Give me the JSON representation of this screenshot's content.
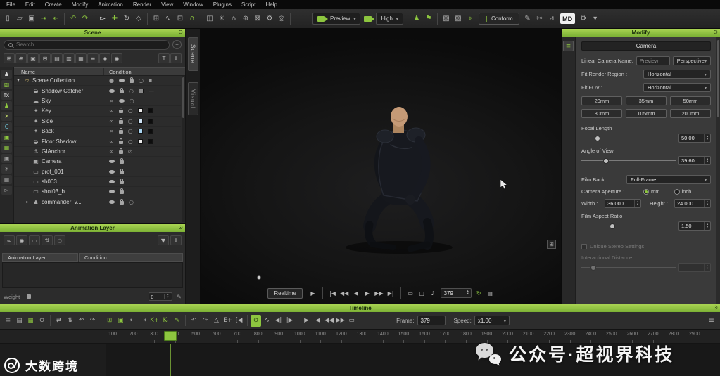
{
  "accent": "#8dc63f",
  "menubar": {
    "items": [
      "File",
      "Edit",
      "Create",
      "Modify",
      "Animation",
      "Render",
      "View",
      "Window",
      "Plugins",
      "Script",
      "Help"
    ]
  },
  "main_toolbar": {
    "left_icons": [
      {
        "name": "new-scene-icon",
        "glyph": "▯"
      },
      {
        "name": "open-scene-icon",
        "glyph": "▱"
      },
      {
        "name": "save-scene-icon",
        "glyph": "▣"
      },
      {
        "name": "import-icon",
        "glyph": "⇥",
        "color": "#8dc63f"
      },
      {
        "name": "export-icon",
        "glyph": "⇤",
        "color": "#8dc63f"
      },
      {
        "sep": true
      },
      {
        "name": "undo-icon",
        "glyph": "↶",
        "color": "#8dc63f"
      },
      {
        "name": "redo-icon",
        "glyph": "↷",
        "color": "#8dc63f"
      },
      {
        "sep": true
      },
      {
        "name": "select-tool-icon",
        "glyph": "▻",
        "color": "#e8e8e8"
      },
      {
        "name": "move-tool-icon",
        "glyph": "✚",
        "color": "#8dc63f"
      },
      {
        "name": "rotate-tool-icon",
        "glyph": "↻"
      },
      {
        "name": "scale-tool-icon",
        "glyph": "◇"
      },
      {
        "sep": true
      },
      {
        "name": "snap-grid-icon",
        "glyph": "⊞"
      },
      {
        "name": "snap-curve-icon",
        "glyph": "∿"
      },
      {
        "name": "snap-point-icon",
        "glyph": "⊡"
      },
      {
        "name": "magnet-icon",
        "glyph": "∩",
        "color": "#8dc63f"
      },
      {
        "sep": true
      },
      {
        "name": "viewport-layout-icon",
        "glyph": "◫"
      },
      {
        "name": "light-icon",
        "glyph": "☀"
      },
      {
        "name": "home-view-icon",
        "glyph": "⌂"
      },
      {
        "name": "frame-selected-icon",
        "glyph": "⊕"
      },
      {
        "name": "frame-all-icon",
        "glyph": "⊠"
      },
      {
        "name": "render-settings-icon",
        "glyph": "⚙"
      },
      {
        "name": "target-icon",
        "glyph": "◎"
      },
      {
        "sep": true
      }
    ],
    "preview_dropdown_label": "Preview",
    "quality_dropdown_label": "High",
    "right_icons": [
      {
        "sep": true
      },
      {
        "name": "character-icon",
        "glyph": "♟",
        "color": "#8dc63f"
      },
      {
        "name": "flag-icon",
        "glyph": "⚑",
        "color": "#8dc63f"
      },
      {
        "sep": true
      },
      {
        "name": "cube-icon",
        "glyph": "▧"
      },
      {
        "name": "cloth-icon",
        "glyph": "▨"
      },
      {
        "name": "pin-icon",
        "glyph": "⌖",
        "color": "#8dc63f"
      }
    ],
    "conform_label": "Conform",
    "end_icons": [
      {
        "name": "brush-icon",
        "glyph": "✎"
      },
      {
        "name": "scissors-icon",
        "glyph": "✂"
      },
      {
        "name": "measure-icon",
        "glyph": "⊿"
      }
    ],
    "logo_text": "MD",
    "end2_icons": [
      {
        "name": "settings-gear-icon",
        "glyph": "⚙"
      },
      {
        "name": "more-options-icon",
        "glyph": "▾"
      }
    ]
  },
  "side_tabs": [
    {
      "label": "Scene"
    },
    {
      "label": "Visual"
    }
  ],
  "scene_panel": {
    "title": "Scene",
    "search_placeholder": "Search",
    "columns": [
      "Name",
      "Condition"
    ],
    "toolbar_icons": [
      {
        "name": "add-collection-icon",
        "glyph": "⊞"
      },
      {
        "name": "add-object-icon",
        "glyph": "⊕"
      },
      {
        "name": "duplicate-icon",
        "glyph": "▣"
      },
      {
        "name": "delete-icon",
        "glyph": "⊟"
      },
      {
        "name": "expand-all-icon",
        "glyph": "▤"
      },
      {
        "name": "collapse-all-icon",
        "glyph": "▥"
      },
      {
        "name": "group-icon",
        "glyph": "▦"
      },
      {
        "name": "flat-list-icon",
        "glyph": "≡"
      },
      {
        "name": "isolate-icon",
        "glyph": "◈"
      },
      {
        "name": "show-all-icon",
        "glyph": "◉"
      },
      {
        "spacer": true
      },
      {
        "name": "text-filter-icon",
        "glyph": "T"
      },
      {
        "name": "import-asset-icon",
        "glyph": "⇓"
      }
    ],
    "filter_icons": [
      {
        "name": "filter-characters-icon",
        "glyph": "♟",
        "color": "#d8d8d8"
      },
      {
        "name": "filter-meshes-icon",
        "glyph": "▧",
        "color": "#8dc63f"
      },
      {
        "name": "filter-effects-icon",
        "glyph": "fx",
        "color": "#d8d8d8"
      },
      {
        "name": "filter-avatars-icon",
        "glyph": "♟",
        "color": "#8dc63f"
      },
      {
        "name": "filter-deleted-icon",
        "glyph": "✕",
        "color": "#c9e26b"
      },
      {
        "name": "filter-constraints-icon",
        "glyph": "C",
        "color": "#6ec6d8"
      },
      {
        "name": "filter-cameras-icon",
        "glyph": "▣",
        "color": "#8dc63f"
      },
      {
        "name": "filter-props-icon",
        "glyph": "▦",
        "color": "#8dc63f"
      },
      {
        "name": "filter-camera2-icon",
        "glyph": "▣",
        "color": "#9a9a9a"
      },
      {
        "name": "filter-lights-icon",
        "glyph": "☀",
        "color": "#9a9a9a"
      },
      {
        "name": "filter-grid-icon",
        "glyph": "▦",
        "color": "#9a9a9a"
      },
      {
        "name": "filter-select-icon",
        "glyph": "▻",
        "color": "#9a9a9a"
      }
    ],
    "rows": [
      {
        "indent": 0,
        "arrow": "▾",
        "icon": "folder",
        "label": "Scene Collection",
        "cond": [
          "dot",
          "eye",
          "lock",
          "circle",
          "square"
        ]
      },
      {
        "indent": 1,
        "icon": "shadow",
        "label": "Shadow Catcher",
        "cond": [
          "eye",
          "lock",
          "circle",
          "sw:#8a8a8a",
          "dash"
        ]
      },
      {
        "indent": 1,
        "icon": "cloud",
        "label": "Sky",
        "cond": [
          "link",
          "eye",
          "circle"
        ]
      },
      {
        "indent": 1,
        "icon": "light",
        "label": "Key",
        "cond": [
          "link",
          "lock",
          "circle",
          "sw:#ececec",
          "sw:#0d0d0d"
        ]
      },
      {
        "indent": 1,
        "icon": "light",
        "label": "Side",
        "cond": [
          "link",
          "lock",
          "circle",
          "sw:#cfe3f5",
          "sw:#0d0d0d"
        ]
      },
      {
        "indent": 1,
        "icon": "light",
        "label": "Back",
        "cond": [
          "link",
          "lock",
          "circle",
          "sw:#a8d4f0",
          "sw:#0d0d0d"
        ]
      },
      {
        "indent": 1,
        "icon": "shadow",
        "label": "Floor Shadow",
        "cond": [
          "link",
          "lock",
          "circle",
          "sw:#ececec",
          "sw:#0d0d0d"
        ]
      },
      {
        "indent": 1,
        "icon": "anchor",
        "label": "GIAnchor",
        "cond": [
          "link",
          "lock",
          "slash"
        ]
      },
      {
        "indent": 1,
        "icon": "camera",
        "label": "Camera",
        "cond": [
          "eye",
          "lock"
        ]
      },
      {
        "indent": 1,
        "icon": "clap",
        "label": "prof_001",
        "cond": [
          "eye",
          "lock"
        ]
      },
      {
        "indent": 1,
        "icon": "clap",
        "label": "sh003",
        "cond": [
          "eye",
          "lock"
        ]
      },
      {
        "indent": 1,
        "icon": "clap",
        "label": "shot03_b",
        "cond": [
          "eye",
          "lock"
        ]
      },
      {
        "indent": 1,
        "arrow": "▸",
        "icon": "person",
        "label": "commander_v...",
        "cond": [
          "eye",
          "lock",
          "circle",
          "dots"
        ]
      }
    ]
  },
  "anim_panel": {
    "title": "Animation Layer",
    "columns": [
      "Animation Layer",
      "Condition"
    ],
    "toolbar_icons": [
      {
        "name": "link-layer-icon",
        "glyph": "∞"
      },
      {
        "name": "solo-layer-icon",
        "glyph": "◉"
      },
      {
        "name": "mute-layer-icon",
        "glyph": "▭"
      },
      {
        "name": "merge-layer-icon",
        "glyph": "⇅"
      },
      {
        "name": "ghost-layer-icon",
        "glyph": "◌"
      },
      {
        "spacer": true
      },
      {
        "name": "filter-layers-icon",
        "glyph": "▼"
      },
      {
        "name": "download-layer-icon",
        "glyph": "⇓"
      }
    ],
    "weight_label": "Weight",
    "weight_value": "0"
  },
  "viewport": {
    "playbar": {
      "realtime_label": "Realtime",
      "frame_value": "379",
      "icons_a": [
        {
          "name": "play-icon",
          "glyph": "▶"
        },
        {
          "sep": true
        },
        {
          "name": "go-start-icon",
          "glyph": "|◀"
        },
        {
          "name": "prev-keyframe-icon",
          "glyph": "◀◀"
        },
        {
          "name": "prev-frame-icon",
          "glyph": "◀"
        },
        {
          "name": "next-frame-icon",
          "glyph": "▶"
        },
        {
          "name": "next-keyframe-icon",
          "glyph": "▶▶"
        },
        {
          "name": "go-end-icon",
          "glyph": "▶|"
        },
        {
          "sep": true
        },
        {
          "name": "playback-range-icon",
          "glyph": "▭"
        },
        {
          "name": "annotation-icon",
          "glyph": "▢"
        },
        {
          "name": "audio-icon",
          "glyph": "♪"
        }
      ],
      "icons_b": [
        {
          "name": "loop-icon",
          "glyph": "↻",
          "color": "#8dc63f"
        },
        {
          "name": "capture-icon",
          "glyph": "▤"
        }
      ]
    }
  },
  "modify_panel": {
    "title": "Modify",
    "section_camera": "Camera",
    "linear_camera_name_label": "Linear Camera Name:",
    "linear_camera_name_value": "Preview",
    "camera_type_value": "Perspective",
    "fit_render_region_label": "Fit Render Region :",
    "fit_render_region_value": "Horizontal",
    "fit_fov_label": "Fit FOV :",
    "fit_fov_value": "Horizontal",
    "focal_presets": [
      "20mm",
      "35mm",
      "50mm",
      "80mm",
      "105mm",
      "200mm"
    ],
    "focal_length_label": "Focal Length",
    "focal_length_value": "50.00",
    "focal_length_slider_pct": 14,
    "angle_of_view_label": "Angle of View",
    "angle_of_view_value": "39.60",
    "angle_of_view_slider_pct": 23,
    "film_back_label": "Film Back :",
    "film_back_value": "Full-Frame",
    "camera_aperture_label": "Camera Aperture :",
    "aperture_unit_mm": "mm",
    "aperture_unit_inch": "inch",
    "width_label": "Width :",
    "width_value": "36.000",
    "height_label": "Height :",
    "height_value": "24.000",
    "film_aspect_ratio_label": "Film Aspect Ratio",
    "film_aspect_ratio_value": "1.50",
    "film_aspect_slider_pct": 30,
    "unique_stereo_label": "Unique Stereo Settings",
    "interaxial_label": "Interactional Distance",
    "interaxial_slider_pct": 10
  },
  "timeline": {
    "title": "Timeline",
    "icons": [
      {
        "name": "layers-menu-icon",
        "glyph": "≡"
      },
      {
        "name": "dope-sheet-icon",
        "glyph": "▤"
      },
      {
        "name": "curve-editor-icon",
        "glyph": "▦",
        "color": "#8dc63f"
      },
      {
        "name": "clip-editor-icon",
        "glyph": "⊙"
      },
      {
        "sep": true
      },
      {
        "name": "swap-range-icon",
        "glyph": "⇄"
      },
      {
        "name": "fit-range-icon",
        "glyph": "⇅"
      },
      {
        "name": "pan-back-icon",
        "glyph": "↶"
      },
      {
        "name": "pan-forward-icon",
        "glyph": "↷"
      },
      {
        "sep": true
      },
      {
        "name": "add-keyframe-icon",
        "glyph": "⊞",
        "color": "#8dc63f"
      },
      {
        "name": "set-keyframe-icon",
        "glyph": "▣",
        "color": "#8dc63f"
      },
      {
        "name": "goto-prev-key-icon",
        "glyph": "⇤"
      },
      {
        "name": "goto-next-key-icon",
        "glyph": "⇥"
      },
      {
        "name": "key-plus-icon",
        "glyph": "K+",
        "color": "#8dc63f"
      },
      {
        "name": "key-minus-icon",
        "glyph": "K-",
        "color": "#8dc63f"
      },
      {
        "name": "edit-keys-icon",
        "glyph": "✎",
        "color": "#8dc63f"
      },
      {
        "sep": true
      },
      {
        "name": "undo-keys-icon",
        "glyph": "↶"
      },
      {
        "name": "redo-keys-icon",
        "glyph": "↷"
      },
      {
        "name": "push-key-icon",
        "glyph": "△"
      },
      {
        "name": "export-keys-icon",
        "glyph": "E+"
      },
      {
        "name": "trim-in-icon",
        "glyph": "[◀"
      },
      {
        "sep": true
      },
      {
        "name": "record-icon",
        "glyph": "⊙",
        "hl": true
      },
      {
        "name": "audio-wave-icon",
        "glyph": "∿"
      },
      {
        "name": "step-back-icon",
        "glyph": "◀|"
      },
      {
        "name": "step-forward-icon",
        "glyph": "|▶"
      },
      {
        "sep": true
      },
      {
        "name": "tl-play-icon",
        "glyph": "▶"
      },
      {
        "name": "tl-reverse-icon",
        "glyph": "◀"
      },
      {
        "name": "tl-fast-back-icon",
        "glyph": "◀◀"
      },
      {
        "name": "tl-fast-forward-icon",
        "glyph": "▶▶"
      },
      {
        "name": "tl-stop-icon",
        "glyph": "▭"
      }
    ],
    "frame_label": "Frame:",
    "frame_value": "379",
    "speed_label": "Speed:",
    "speed_value": "x1.00",
    "ruler_start": 100,
    "ruler_end": 2900,
    "ruler_step": 100,
    "current_frame": 379
  },
  "watermark": {
    "left": "大数跨境",
    "center": "公众号·超视界科技"
  }
}
